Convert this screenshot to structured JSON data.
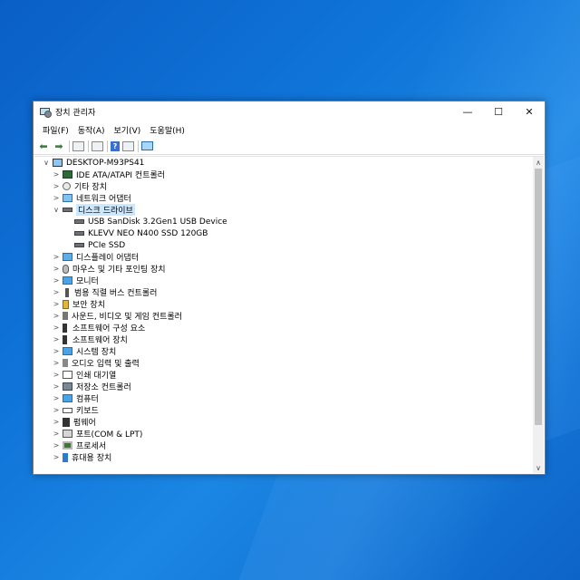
{
  "window": {
    "title": "장치 관리자",
    "controls": {
      "minimize": "—",
      "maximize": "☐",
      "close": "✕"
    }
  },
  "menu": [
    "파일(F)",
    "동작(A)",
    "보기(V)",
    "도움말(H)"
  ],
  "toolbar": [
    "back",
    "forward",
    "properties",
    "list",
    "help",
    "view",
    "monitor"
  ],
  "tree": {
    "root": "DESKTOP-M93PS41",
    "items": [
      {
        "label": "IDE ATA/ATAPI 컨트롤러",
        "icon": "chip",
        "expanded": false
      },
      {
        "label": "기타 장치",
        "icon": "question",
        "expanded": false
      },
      {
        "label": "네트워크 어댑터",
        "icon": "network",
        "expanded": false
      },
      {
        "label": "디스크 드라이브",
        "icon": "disk",
        "expanded": true,
        "selected": true,
        "children": [
          "USB  SanDisk 3.2Gen1 USB Device",
          "KLEVV NEO N400 SSD 120GB",
          "PCIe SSD"
        ]
      },
      {
        "label": "디스플레이 어댑터",
        "icon": "display",
        "expanded": false
      },
      {
        "label": "마우스 및 기타 포인팅 장치",
        "icon": "mouse",
        "expanded": false
      },
      {
        "label": "모니터",
        "icon": "monitor",
        "expanded": false
      },
      {
        "label": "범용 직렬 버스 컨트롤러",
        "icon": "usb",
        "expanded": false
      },
      {
        "label": "보안 장치",
        "icon": "key",
        "expanded": false
      },
      {
        "label": "사운드, 비디오 및 게임 컨트롤러",
        "icon": "speaker",
        "expanded": false
      },
      {
        "label": "소프트웨어 구성 요소",
        "icon": "software-component",
        "expanded": false
      },
      {
        "label": "소프트웨어 장치",
        "icon": "software",
        "expanded": false
      },
      {
        "label": "시스템 장치",
        "icon": "system",
        "expanded": false
      },
      {
        "label": "오디오 입력 및 출력",
        "icon": "audio",
        "expanded": false
      },
      {
        "label": "인쇄 대기열",
        "icon": "printer",
        "expanded": false
      },
      {
        "label": "저장소 컨트롤러",
        "icon": "storage",
        "expanded": false
      },
      {
        "label": "컴퓨터",
        "icon": "computer",
        "expanded": false
      },
      {
        "label": "키보드",
        "icon": "keyboard",
        "expanded": false
      },
      {
        "label": "펌웨어",
        "icon": "firmware",
        "expanded": false
      },
      {
        "label": "포트(COM & LPT)",
        "icon": "port",
        "expanded": false
      },
      {
        "label": "프로세서",
        "icon": "processor",
        "expanded": false
      },
      {
        "label": "휴대용 장치",
        "icon": "portable",
        "expanded": false
      }
    ]
  },
  "colors": {
    "selection": "#cce8ff",
    "desktop": "#0f74d8"
  }
}
